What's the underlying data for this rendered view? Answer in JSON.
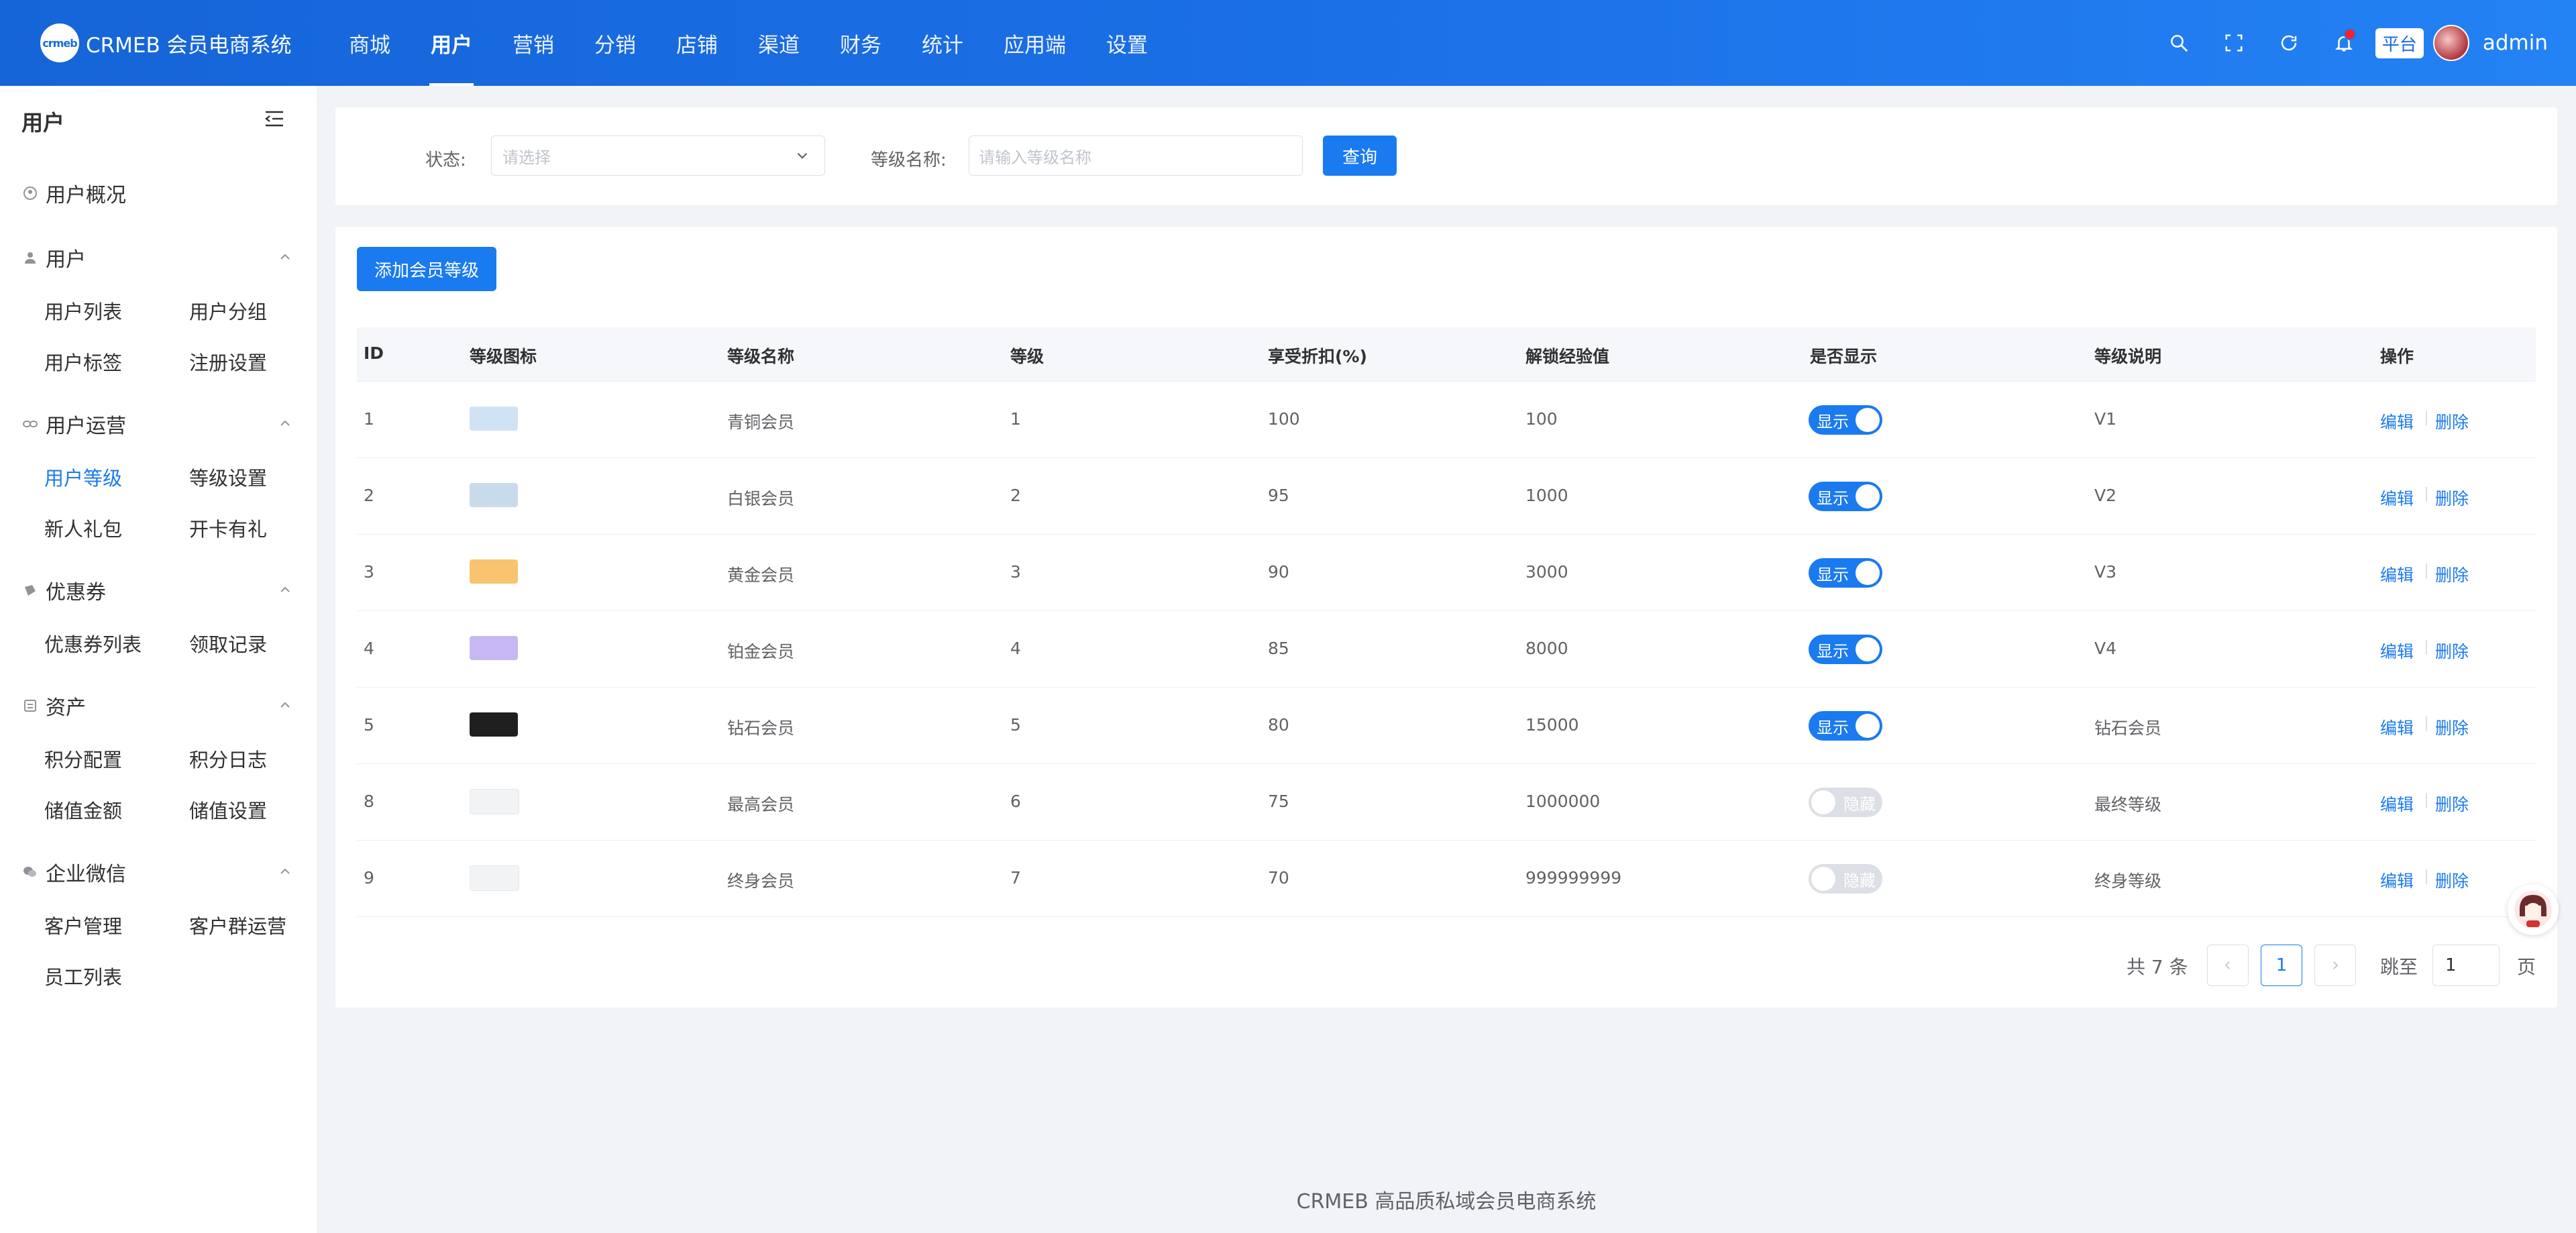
{
  "header": {
    "logo_mark": "crmeb",
    "logo_text": "CRMEB 会员电商系统",
    "nav": [
      "商城",
      "用户",
      "营销",
      "分销",
      "店铺",
      "渠道",
      "财务",
      "统计",
      "应用端",
      "设置"
    ],
    "active_nav": "用户",
    "platform_tag": "平台",
    "user_name": "admin",
    "icons": [
      "search-icon",
      "fullscreen-icon",
      "refresh-icon",
      "bell-icon"
    ]
  },
  "sidebar": {
    "title": "用户",
    "groups": [
      {
        "label": "用户概况",
        "icon": "user-circle-icon"
      },
      {
        "label": "用户",
        "icon": "user-icon",
        "items": [
          "用户列表",
          "用户分组",
          "用户标签",
          "注册设置"
        ]
      },
      {
        "label": "用户运营",
        "icon": "link-icon",
        "items": [
          "用户等级",
          "等级设置",
          "新人礼包",
          "开卡有礼"
        ]
      },
      {
        "label": "优惠券",
        "icon": "coupon-icon",
        "items": [
          "优惠券列表",
          "领取记录"
        ]
      },
      {
        "label": "资产",
        "icon": "asset-icon",
        "items": [
          "积分配置",
          "积分日志",
          "储值金额",
          "储值设置"
        ]
      },
      {
        "label": "企业微信",
        "icon": "wechat-icon",
        "items": [
          "客户管理",
          "客户群运营",
          "员工列表"
        ]
      }
    ],
    "active_item": "用户等级"
  },
  "filter": {
    "status_label": "状态:",
    "status_placeholder": "请选择",
    "name_label": "等级名称:",
    "name_placeholder": "请输入等级名称",
    "query_button": "查询"
  },
  "table": {
    "add_button": "添加会员等级",
    "columns": [
      "ID",
      "等级图标",
      "等级名称",
      "等级",
      "享受折扣(%)",
      "解锁经验值",
      "是否显示",
      "等级说明",
      "操作"
    ],
    "rows": [
      {
        "id": "1",
        "name": "青铜会员",
        "grade": "1",
        "discount": "100",
        "exp": "100",
        "visible": true,
        "desc": "V1",
        "icon_color": "#cfe3f5"
      },
      {
        "id": "2",
        "name": "白银会员",
        "grade": "2",
        "discount": "95",
        "exp": "1000",
        "visible": true,
        "desc": "V2",
        "icon_color": "#c9dbeb"
      },
      {
        "id": "3",
        "name": "黄金会员",
        "grade": "3",
        "discount": "90",
        "exp": "3000",
        "visible": true,
        "desc": "V3",
        "icon_color": "#f8c46f"
      },
      {
        "id": "4",
        "name": "铂金会员",
        "grade": "4",
        "discount": "85",
        "exp": "8000",
        "visible": true,
        "desc": "V4",
        "icon_color": "#c7b8f4"
      },
      {
        "id": "5",
        "name": "钻石会员",
        "grade": "5",
        "discount": "80",
        "exp": "15000",
        "visible": true,
        "desc": "钻石会员",
        "icon_color": "#1f1f1f"
      },
      {
        "id": "8",
        "name": "最高会员",
        "grade": "6",
        "discount": "75",
        "exp": "1000000",
        "visible": false,
        "desc": "最终等级",
        "icon_color": "#f2f3f5"
      },
      {
        "id": "9",
        "name": "终身会员",
        "grade": "7",
        "discount": "70",
        "exp": "999999999",
        "visible": false,
        "desc": "终身等级",
        "icon_color": "#f2f3f5"
      }
    ],
    "switch_on_label": "显示",
    "switch_off_label": "隐藏",
    "edit_label": "编辑",
    "delete_label": "删除"
  },
  "pagination": {
    "total": "共 7 条",
    "current_page": "1",
    "goto_label": "跳至",
    "goto_value": "1",
    "page_unit": "页"
  },
  "footer": "CRMEB 高品质私域会员电商系统",
  "colors": {
    "primary": "#1a7af0",
    "header_start": "#1565d8",
    "header_end": "#2382f4"
  }
}
